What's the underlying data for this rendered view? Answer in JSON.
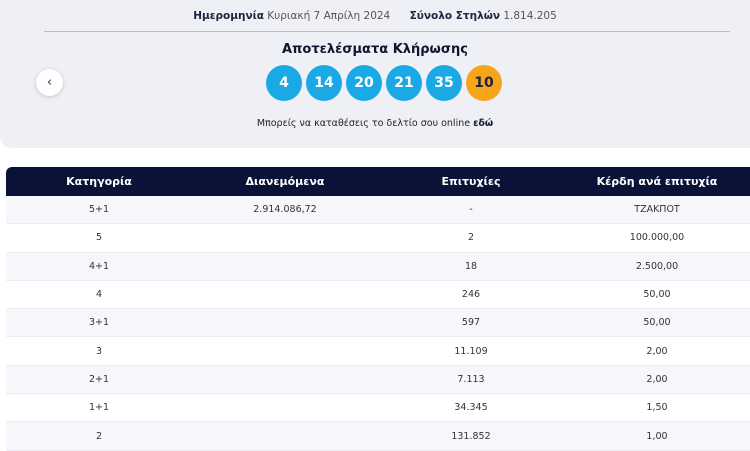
{
  "draw_info": {
    "date_label": "Ημερομηνία",
    "date_value": "Κυριακή 7 Απρίλη 2024",
    "columns_label": "Σύνολο Στηλών",
    "columns_value": "1.814.205"
  },
  "results": {
    "title": "Αποτελέσματα Κλήρωσης",
    "numbers": [
      "4",
      "14",
      "20",
      "21",
      "35"
    ],
    "joker": "10",
    "main_ball_color": "#1ba9e6",
    "joker_ball_color": "#f6a51b"
  },
  "navigation": {
    "prev_icon": "chevron-left-icon",
    "prev_glyph": "‹"
  },
  "note": {
    "text": "Μπορείς να καταθέσεις το δελτίο σου online",
    "link": "εδώ"
  },
  "table": {
    "headers": [
      "Κατηγορία",
      "Διανεμόμενα",
      "Επιτυχίες",
      "Κέρδη ανά επιτυχία"
    ],
    "rows": [
      [
        "5+1",
        "2.914.086,72",
        "-",
        "ΤΖΑΚΠΟΤ"
      ],
      [
        "5",
        "",
        "2",
        "100.000,00"
      ],
      [
        "4+1",
        "",
        "18",
        "2.500,00"
      ],
      [
        "4",
        "",
        "246",
        "50,00"
      ],
      [
        "3+1",
        "",
        "597",
        "50,00"
      ],
      [
        "3",
        "",
        "11.109",
        "2,00"
      ],
      [
        "2+1",
        "",
        "7.113",
        "2,00"
      ],
      [
        "1+1",
        "",
        "34.345",
        "1,50"
      ],
      [
        "2",
        "",
        "131.852",
        "1,00"
      ]
    ],
    "header_color": "#0a1337"
  }
}
